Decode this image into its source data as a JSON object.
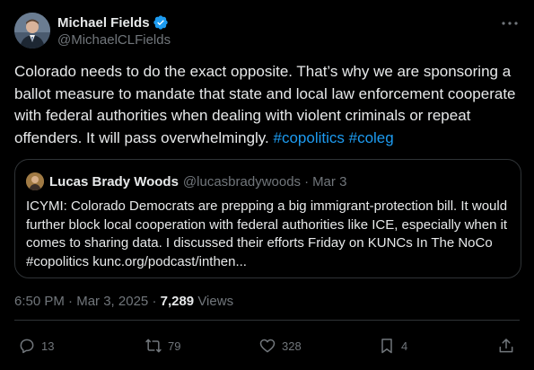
{
  "author": {
    "display_name": "Michael Fields",
    "handle": "@MichaelCLFields",
    "avatar_icon": "profile-photo",
    "verified_icon": "verified-badge-icon",
    "verified_color": "#1d9bf0"
  },
  "tweet": {
    "text": "Colorado needs to do the exact opposite. That’s why we are sponsoring a ballot measure to mandate that state and local law enforcement cooperate with federal authorities when dealing with violent criminals or repeat offenders. It will pass overwhelmingly.",
    "hashtags": [
      "#copolitics",
      "#coleg"
    ],
    "hashtag_color": "#1d9bf0"
  },
  "quote": {
    "display_name": "Lucas Brady Woods",
    "handle": "@lucasbradywoods",
    "separator": "·",
    "date": "Mar 3",
    "text": "ICYMI: Colorado Democrats are prepping a big immigrant-protection bill. It would further block local cooperation with federal authorities like ICE, especially when it comes to sharing data. I discussed their efforts Friday on KUNCs In The NoCo #copolitics kunc.org/podcast/inthen..."
  },
  "meta": {
    "time": "6:50 PM",
    "separator": "·",
    "date": "Mar 3, 2025",
    "views_count": "7,289",
    "views_label": "Views"
  },
  "actions": {
    "replies": "13",
    "reposts": "79",
    "likes": "328",
    "bookmarks": "4"
  },
  "colors": {
    "background": "#000000",
    "text_primary": "#e7e9ea",
    "text_secondary": "#71767b",
    "border": "#2f3336",
    "accent": "#1d9bf0"
  }
}
